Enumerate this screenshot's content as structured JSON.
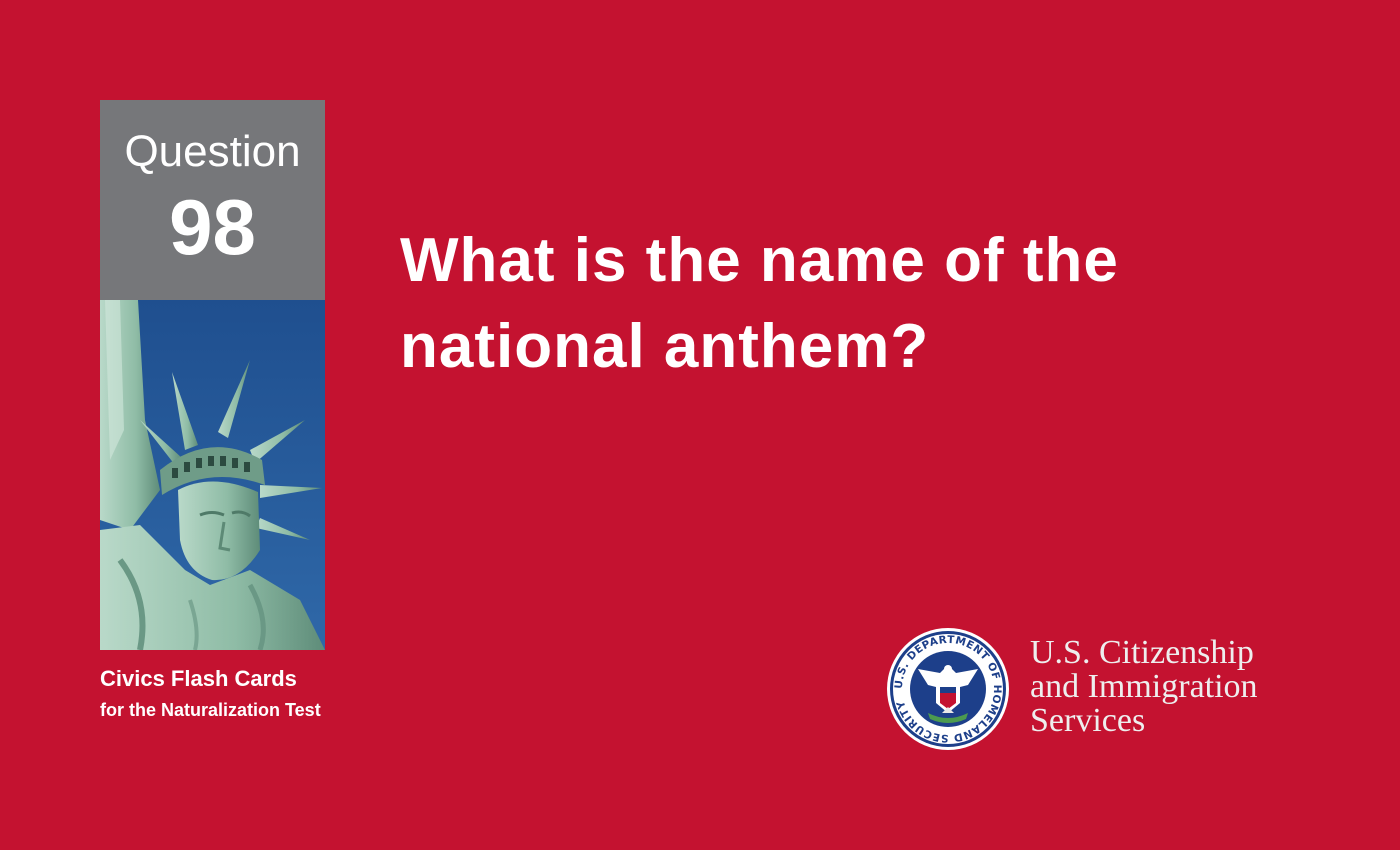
{
  "colors": {
    "background": "#c41230",
    "question_box": "#76777a",
    "text": "#ffffff",
    "sky": "#2a5f9e",
    "statue": "#9fc6b4"
  },
  "card": {
    "question_word": "Question",
    "question_number": "98",
    "question_text": "What is the name of the national anthem?"
  },
  "caption": {
    "title": "Civics Flash Cards",
    "subtitle": "for the Naturalization Test"
  },
  "seal": {
    "icon": "dhs-seal-icon",
    "ring_text": "U.S. DEPARTMENT OF HOMELAND SECURITY"
  },
  "agency": {
    "line1": "U.S. Citizenship",
    "line2": "and Immigration",
    "line3": "Services"
  },
  "photo": {
    "icon": "statue-of-liberty-icon"
  }
}
